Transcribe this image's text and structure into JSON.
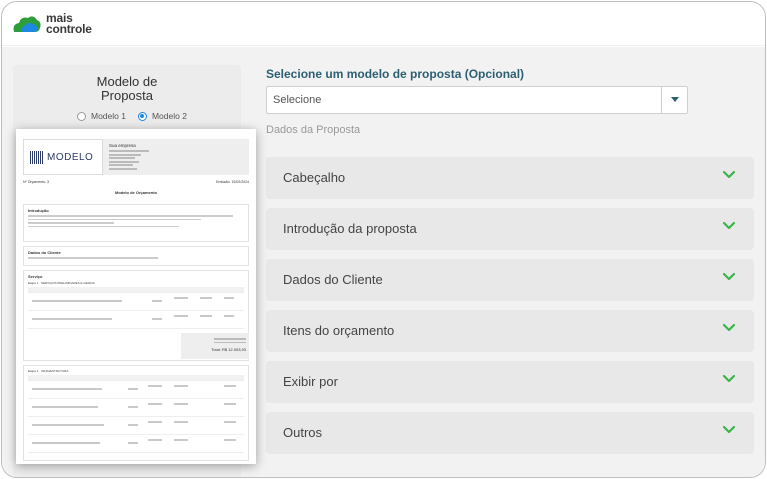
{
  "app": {
    "logo_line1": "mais",
    "logo_line2": "controle",
    "brand_colors": {
      "green": "#2e9e3a",
      "blue": "#1e88e5",
      "teal": "#2d5f71",
      "check": "#3bb54a"
    }
  },
  "left": {
    "title": "Modelo de Proposta",
    "radio_options": [
      {
        "label": "Modelo 1",
        "selected": false
      },
      {
        "label": "Modelo 2",
        "selected": true
      }
    ],
    "preview": {
      "logo_word": "MODELO",
      "company_name": "Sua empresa",
      "budget_number": "Nº Orçamento: 3",
      "emission": "Emissão: 19/02/2024",
      "doc_title": "Modelo de Orçamento",
      "intro_heading": "Introdução",
      "client_heading": "Dados do Cliente",
      "service_heading": "Serviço",
      "stage1": "Etapa 1 · SERVIÇOS PRELIMINARES E GERAIS",
      "stage2": "Etapa 2 · INFRAESTRUTURA",
      "total": "Total: R$ 12.003,93"
    }
  },
  "right": {
    "title": "Selecione um modelo de proposta (Opcional)",
    "select": {
      "value": "Selecione"
    },
    "section_label": "Dados da Proposta",
    "accordion": [
      {
        "label": "Cabeçalho"
      },
      {
        "label": "Introdução da proposta"
      },
      {
        "label": "Dados do Cliente"
      },
      {
        "label": "Itens do orçamento"
      },
      {
        "label": "Exibir por"
      },
      {
        "label": "Outros"
      }
    ]
  }
}
